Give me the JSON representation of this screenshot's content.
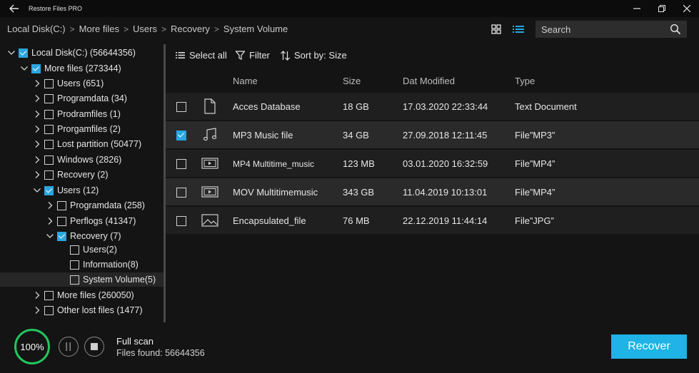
{
  "app": {
    "title": "Restore Files PRO"
  },
  "breadcrumb": [
    "Local Disk(C:)",
    "More files",
    "Users",
    "Recovery",
    "System Volume"
  ],
  "search": {
    "placeholder": "Search"
  },
  "tree": [
    {
      "label": "Local Disk(C:) (56644356)",
      "level": 0,
      "expanded": true,
      "checked": true
    },
    {
      "label": "More files (273344)",
      "level": 1,
      "expanded": true,
      "checked": true
    },
    {
      "label": "Users (651)",
      "level": 2,
      "expanded": false,
      "checked": false
    },
    {
      "label": "Programdata (34)",
      "level": 2,
      "expanded": false,
      "checked": false
    },
    {
      "label": "Prodramfiles (1)",
      "level": 2,
      "expanded": false,
      "checked": false
    },
    {
      "label": "Prorgamfiles (2)",
      "level": 2,
      "expanded": false,
      "checked": false
    },
    {
      "label": "Lost partition (50477)",
      "level": 2,
      "expanded": false,
      "checked": false
    },
    {
      "label": "Windows (2826)",
      "level": 2,
      "expanded": false,
      "checked": false
    },
    {
      "label": "Recovery (2)",
      "level": 2,
      "expanded": false,
      "checked": false
    },
    {
      "label": "Users (12)",
      "level": 2,
      "expanded": true,
      "checked": true
    },
    {
      "label": "Programdata (258)",
      "level": 3,
      "expanded": false,
      "checked": false
    },
    {
      "label": "Perflogs (41347)",
      "level": 3,
      "expanded": false,
      "checked": false
    },
    {
      "label": "Recovery (7)",
      "level": 3,
      "expanded": true,
      "checked": true
    },
    {
      "label": "Users(2)",
      "level": 4,
      "expanded": null,
      "checked": false
    },
    {
      "label": "Information(8)",
      "level": 4,
      "expanded": null,
      "checked": false
    },
    {
      "label": "System Volume(5)",
      "level": 4,
      "expanded": null,
      "checked": false,
      "selected": true
    },
    {
      "label": "More files (260050)",
      "level": 2,
      "expanded": false,
      "checked": false
    },
    {
      "label": "Other lost files (1477)",
      "level": 2,
      "expanded": false,
      "checked": false
    }
  ],
  "actions": {
    "select_all": "Select all",
    "filter": "Filter",
    "sort": "Sort by: Size"
  },
  "columns": {
    "name": "Name",
    "size": "Size",
    "date": "Dat Modified",
    "type": "Type"
  },
  "files": [
    {
      "name": "Acces Database",
      "size": "18 GB",
      "date": "17.03.2020 22:33:44",
      "type": "Text Document",
      "icon": "document-icon",
      "checked": false
    },
    {
      "name": "MP3 Music file",
      "size": "34 GB",
      "date": "27.09.2018 12:11:45",
      "type": "File”MP3”",
      "icon": "music-icon",
      "checked": true
    },
    {
      "name": "MP4 Multitime_music",
      "size": "123 MB",
      "date": "03.01.2020 16:32:59",
      "type": "File”MP4”",
      "icon": "video-icon",
      "checked": false
    },
    {
      "name": "MOV Multitimemusic",
      "size": "343 GB",
      "date": "11.04.2019 10:13:01",
      "type": "File”MP4”",
      "icon": "video-icon",
      "checked": false
    },
    {
      "name": "Encapsulated_file",
      "size": "76 MB",
      "date": "22.12.2019 11:44:14",
      "type": "File”JPG”",
      "icon": "image-icon",
      "checked": false
    }
  ],
  "status": {
    "progress": "100%",
    "progress_fraction": 1.0,
    "scan_title": "Full scan",
    "files_found": "Files found: 56644356"
  },
  "recover_label": "Recover",
  "colors": {
    "accent": "#1fb3e6",
    "checkbox": "#2aa6e0",
    "progress": "#22c55e",
    "background": "#141414"
  }
}
